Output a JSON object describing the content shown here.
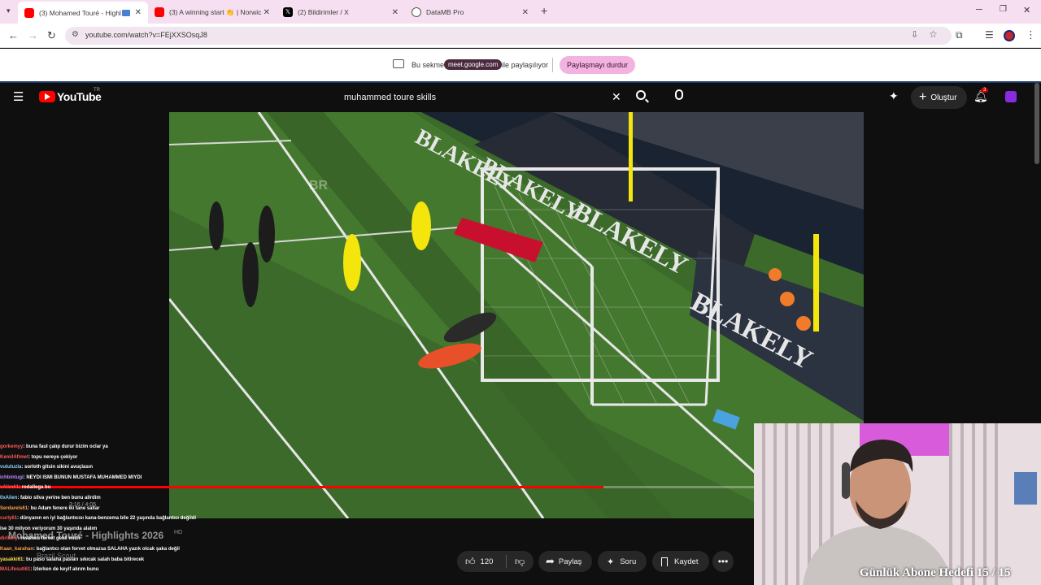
{
  "browser": {
    "tabs": [
      {
        "title": "(3) Mohamed Touré - Highl",
        "active": true,
        "icon": "youtube-icon"
      },
      {
        "title": "(3) A winning start 👏 | Norwic",
        "active": false,
        "icon": "youtube-icon"
      },
      {
        "title": "(2) Bildirimler / X",
        "active": false,
        "icon": "x-icon"
      },
      {
        "title": "DataMB Pro",
        "active": false,
        "icon": "globe-icon"
      }
    ],
    "url": "youtube.com/watch?v=FEjXXSOsqJ8"
  },
  "share_bar": {
    "text_before": "Bu sekme",
    "domain": "meet.google.com",
    "text_after": "ile paylaşılıyor",
    "stop_button": "Paylaşmayı durdur"
  },
  "youtube": {
    "logo": "YouTube",
    "region": "TR",
    "search_value": "muhammed toure skills",
    "create_label": "Oluştur",
    "notification_count": "3"
  },
  "video": {
    "title": "Mohamed Touré - Highlights 2026",
    "quality": "HD",
    "channel": "Brazil Scout",
    "time": "3:16 / 4:05",
    "progress": 0.8,
    "ad_text": "BLAKELY",
    "watermark": "BR"
  },
  "actions": {
    "likes": "120",
    "share": "Paylaş",
    "ask": "Soru",
    "save": "Kaydet"
  },
  "chat": [
    {
      "user": "gorkemyy",
      "color": "#ff5a5a",
      "msg": ": buna faul çalıp durur bizim oclar ya"
    },
    {
      "user": "KemilAfimet",
      "color": "#ff5a5a",
      "msg": ": topu nereye çekiyor"
    },
    {
      "user": "vututuzla",
      "color": "#8fd3ff",
      "msg": ": sorloth gitsin sikini avuçlasın"
    },
    {
      "user": "ichbintugi",
      "color": "#b68cff",
      "msg": ": NEYDI ISMI BUNUN MUSTAFA MUHAMMED MIYDI"
    },
    {
      "user": "vAlim61",
      "color": "#ff5a5a",
      "msg": ": rodallega bu"
    },
    {
      "user": "0xAlien",
      "color": "#8fd3ff",
      "msg": ": fabio silva yerine ben bunu alirdim"
    },
    {
      "user": "Serdarels61",
      "color": "#ff9f4a",
      "msg": ": bu Adam fenere iki tane sallar"
    },
    {
      "user": "curly61",
      "color": "#ff5a5a",
      "msg": ": dünyanın en iyi bağlantıcısı kana-benzema bile 22 yaşında bağlantıcı değildi"
    },
    {
      "user": "",
      "color": "#ff5a5a",
      "msg": "ise 30 milyon veriyorum 30 yaşında alalım"
    },
    {
      "user": "dirikery",
      "color": "#ff5a5a",
      "msg": ": nwahwu forvet gekli midir"
    },
    {
      "user": "Kaan_karahan",
      "color": "#ff9f4a",
      "msg": ": bağlantıcı olan forvet olmazsa SALAHA yazık olcak şaka değil"
    },
    {
      "user": "yasakki61",
      "color": "#ffe14a",
      "msg": ": bu paso salaha pasları sıkıcak salah baba bitirecek"
    },
    {
      "user": "MALifesuti61",
      "color": "#ff5a5a",
      "msg": ": İzlerken de keyif alırım bunu"
    }
  ],
  "stream_overlay": {
    "goal_text": "Günlük Abone Hedefi 15 / 15"
  },
  "colors": {
    "youtube_red": "#ff0000",
    "share_pill": "#f2b3e0",
    "share_domain": "#1f1f1f",
    "tabbar_bg": "#f6dff0",
    "progress_red": "#ff0000"
  }
}
